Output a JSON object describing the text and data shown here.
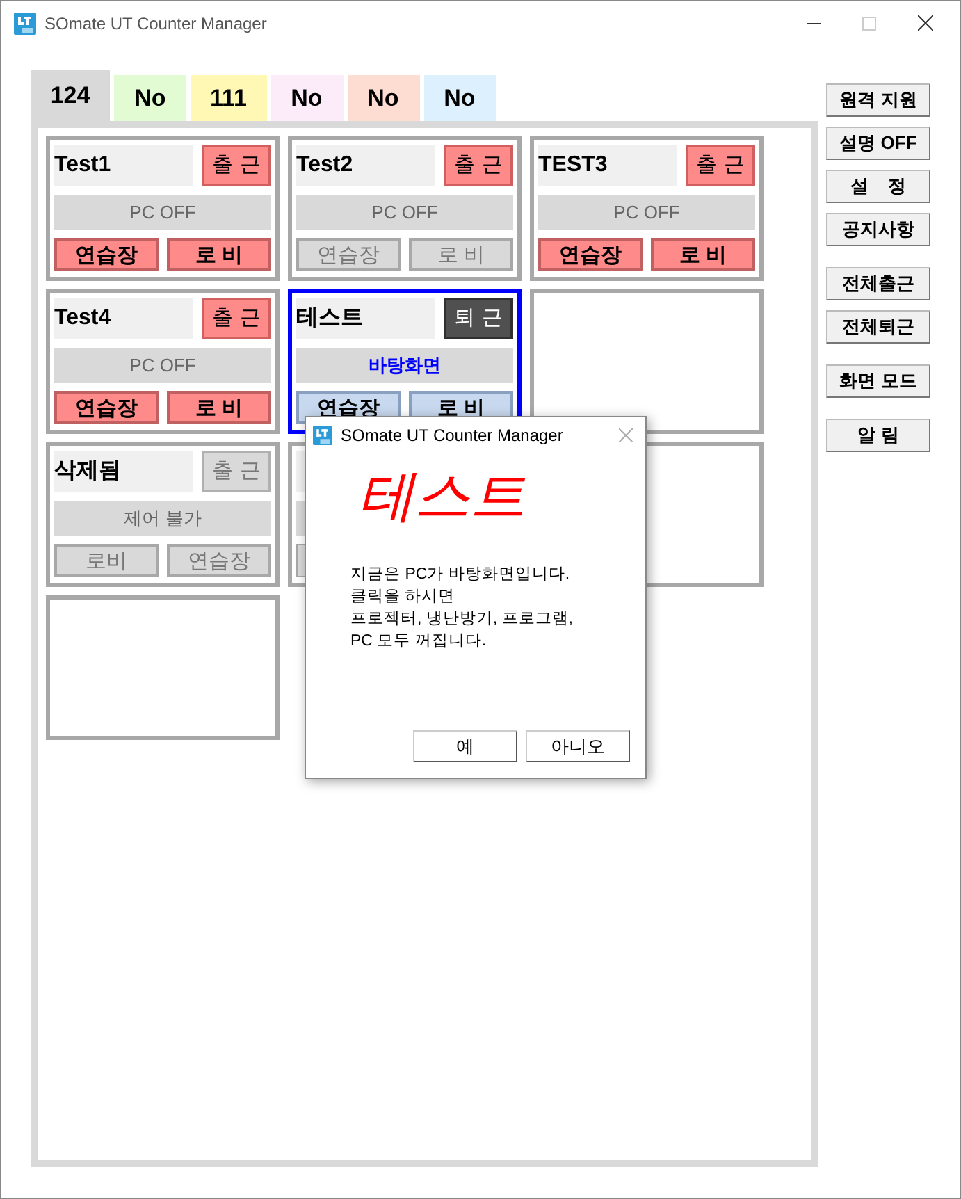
{
  "window": {
    "title": "SOmate UT Counter Manager"
  },
  "tabs": [
    {
      "label": "124",
      "selected": true,
      "color": "#d9d9d9"
    },
    {
      "label": "No",
      "selected": false,
      "color": "#e2fbd2"
    },
    {
      "label": "111",
      "selected": false,
      "color": "#fff8b4"
    },
    {
      "label": "No",
      "selected": false,
      "color": "#fcebf8"
    },
    {
      "label": "No",
      "selected": false,
      "color": "#fddcd2"
    },
    {
      "label": "No",
      "selected": false,
      "color": "#dcf0fd"
    }
  ],
  "cards": [
    {
      "kind": "room",
      "selected": false,
      "name": "Test1",
      "action": {
        "label": "출 근",
        "kind": "on"
      },
      "status": {
        "text": "PC OFF",
        "kind": "off"
      },
      "buttons": [
        {
          "label": "연습장",
          "kind": "on"
        },
        {
          "label": "로 비",
          "kind": "on"
        }
      ]
    },
    {
      "kind": "room",
      "selected": false,
      "name": "Test2",
      "action": {
        "label": "출 근",
        "kind": "on"
      },
      "status": {
        "text": "PC OFF",
        "kind": "off"
      },
      "buttons": [
        {
          "label": "연습장",
          "kind": "idle"
        },
        {
          "label": "로 비",
          "kind": "idle"
        }
      ]
    },
    {
      "kind": "room",
      "selected": false,
      "name": "TEST3",
      "action": {
        "label": "출 근",
        "kind": "on"
      },
      "status": {
        "text": "PC OFF",
        "kind": "off"
      },
      "buttons": [
        {
          "label": "연습장",
          "kind": "on"
        },
        {
          "label": "로 비",
          "kind": "on"
        }
      ]
    },
    {
      "kind": "room",
      "selected": false,
      "name": "Test4",
      "action": {
        "label": "출 근",
        "kind": "on"
      },
      "status": {
        "text": "PC OFF",
        "kind": "off"
      },
      "buttons": [
        {
          "label": "연습장",
          "kind": "on"
        },
        {
          "label": "로 비",
          "kind": "on"
        }
      ]
    },
    {
      "kind": "room",
      "selected": true,
      "name": "테스트",
      "action": {
        "label": "퇴 근",
        "kind": "leave"
      },
      "status": {
        "text": "바탕화면",
        "kind": "desktop"
      },
      "buttons": [
        {
          "label": "연습장",
          "kind": "active"
        },
        {
          "label": "로 비",
          "kind": "active"
        }
      ]
    },
    {
      "kind": "empty",
      "selected": false
    },
    {
      "kind": "room",
      "selected": false,
      "name": "삭제됨",
      "action": {
        "label": "출 근",
        "kind": "disabled"
      },
      "status": {
        "text": "제어 불가",
        "kind": "disabled"
      },
      "buttons": [
        {
          "label": "로비",
          "kind": "idle"
        },
        {
          "label": "연습장",
          "kind": "idle"
        }
      ]
    },
    {
      "kind": "hidden",
      "selected": false
    },
    {
      "kind": "empty",
      "selected": false
    },
    {
      "kind": "empty",
      "selected": false
    }
  ],
  "side_button_groups": [
    [
      "원격 지원",
      "설명 OFF",
      "설    정",
      "공지사항"
    ],
    [
      "전체출근",
      "전체퇴근"
    ],
    [
      "화면 모드"
    ],
    [
      "알 림"
    ]
  ],
  "dialog": {
    "title": "SOmate UT Counter Manager",
    "heading": "테스트",
    "message": [
      "지금은 PC가 바탕화면입니다.",
      "클릭을 하시면",
      "프로젝터, 냉난방기, 프로그램,",
      "PC 모두 꺼집니다."
    ],
    "buttons": [
      "예",
      "아니오"
    ]
  }
}
